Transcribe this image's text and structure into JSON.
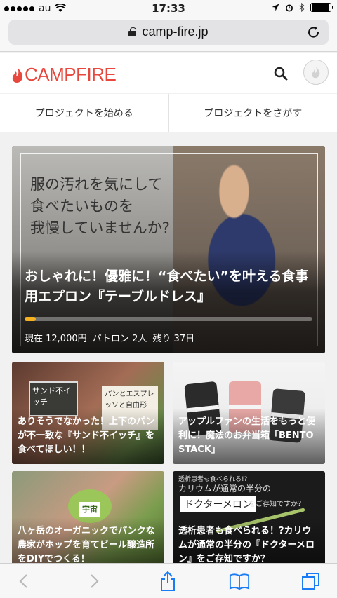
{
  "status_bar": {
    "carrier": "au",
    "time": "17:33",
    "battery_level": 0.95
  },
  "browser": {
    "url": "camp-fire.jp"
  },
  "header": {
    "logo_text": "CAMPFIRE",
    "brand_color": "#e8473d"
  },
  "nav": {
    "start_project": "プロジェクトを始める",
    "find_project": "プロジェクトをさがす"
  },
  "hero": {
    "tagline_1": "服の汚れを気にして",
    "tagline_2": "食べたいものを",
    "tagline_3": "我慢していませんか?",
    "title": "おしゃれに！優雅に！“食べたい”を叶える食事用エプロン『テーブルドレス』",
    "funded_fraction": 0.04,
    "stats": {
      "amount": "現在 12,000円",
      "patrons": "パトロン 2人",
      "remaining": "残り 37日"
    }
  },
  "cards": [
    {
      "title": "ありそうでなかった！上下のパンが不一致な『サンド不イッチ』を食べてほしい！！",
      "image_box_text": "サンド不イッチ",
      "image_label_text": "パンとエスプレッソと自由形"
    },
    {
      "title": "アップルファンの生活をもっと便利に！魔法のお弁当箱「BENTO STACK」"
    },
    {
      "title": "八ヶ岳のオーガニックでパンクな農家がホップを育てビール醸造所をDIYでつくる！",
      "image_sign_text": "宇宙"
    },
    {
      "title": "透析患者も食べられる！?カリウムが通常の半分の『ドクターメロン』をご存知ですか？",
      "image_top_text": "透析患者も食べられる!?",
      "image_mid_text": "カリウムが通常の半分の",
      "image_doctor_text": "ドクターメロン",
      "image_ask_text": "をご存知ですか？"
    }
  ],
  "toolbar": {
    "icons": [
      "back-icon",
      "forward-icon",
      "share-icon",
      "bookmarks-icon",
      "tabs-icon"
    ]
  }
}
